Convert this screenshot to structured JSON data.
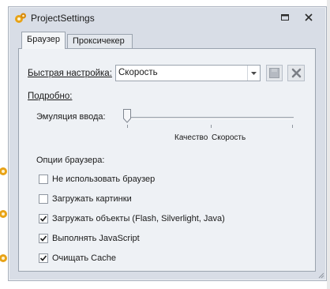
{
  "window": {
    "title": "ProjectSettings",
    "icon": "project-settings-icon"
  },
  "titlebar_buttons": {
    "restore_icon": "restore-icon",
    "close_icon": "close-icon"
  },
  "tabs": [
    {
      "label": "Браузер",
      "active": true
    },
    {
      "label": "Проксичекер",
      "active": false
    }
  ],
  "browser": {
    "quick_setting_label": "Быстрая настройка:",
    "quick_setting_value": "Скорость",
    "detail_label": "Подробно:",
    "input_emulation_label": "Эмуляция ввода:",
    "slider_labels": {
      "quality": "Качество",
      "speed": "Скорость"
    },
    "slider_value_fraction": 0.0,
    "options_label": "Опции браузера:",
    "options": [
      {
        "label": "Не использовать браузер",
        "checked": false
      },
      {
        "label": "Загружать картинки",
        "checked": false
      },
      {
        "label": "Загружать объекты (Flash, Silverlight, Java)",
        "checked": true
      },
      {
        "label": "Выполнять JavaScript",
        "checked": true
      },
      {
        "label": "Очищать Cache",
        "checked": true
      }
    ]
  },
  "colors": {
    "window_bg": "#d8dde6",
    "panel_bg": "#eef1f5",
    "accent_gear": "#e8a317"
  }
}
